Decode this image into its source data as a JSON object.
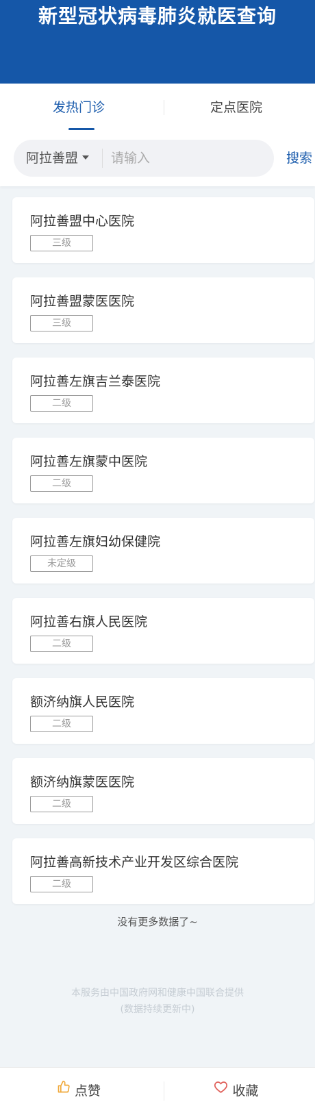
{
  "header": {
    "title": "新型冠状病毒肺炎就医查询",
    "background_color": "#1557a8"
  },
  "tabs": [
    {
      "label": "发热门诊",
      "active": true
    },
    {
      "label": "定点医院",
      "active": false
    }
  ],
  "search": {
    "region": "阿拉善盟",
    "placeholder": "请输入",
    "value": "",
    "button_label": "搜索"
  },
  "hospitals": [
    {
      "name": "阿拉善盟中心医院",
      "level": "三级"
    },
    {
      "name": "阿拉善盟蒙医医院",
      "level": "三级"
    },
    {
      "name": "阿拉善左旗吉兰泰医院",
      "level": "二级"
    },
    {
      "name": "阿拉善左旗蒙中医院",
      "level": "二级"
    },
    {
      "name": "阿拉善左旗妇幼保健院",
      "level": "未定级"
    },
    {
      "name": "阿拉善右旗人民医院",
      "level": "二级"
    },
    {
      "name": "额济纳旗人民医院",
      "level": "二级"
    },
    {
      "name": "额济纳旗蒙医医院",
      "level": "二级"
    },
    {
      "name": "阿拉善高新技术产业开发区综合医院",
      "level": "二级"
    }
  ],
  "list_end": "没有更多数据了~",
  "footnote": {
    "line1": "本服务由中国政府网和健康中国联合提供",
    "line2": "(数据持续更新中)"
  },
  "bottom_bar": {
    "like_label": "点赞",
    "like_icon": "thumbs-up-icon",
    "like_color": "#f0a93a",
    "favorite_label": "收藏",
    "favorite_icon": "heart-icon",
    "favorite_color": "#e0605a"
  }
}
